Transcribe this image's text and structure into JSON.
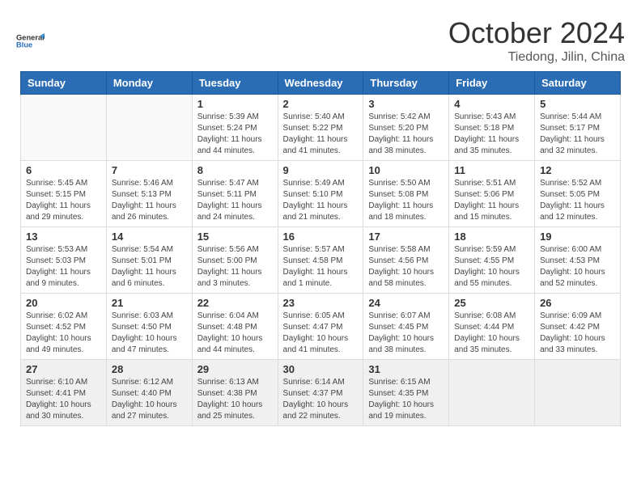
{
  "header": {
    "logo": {
      "general": "General",
      "blue": "Blue"
    },
    "title": "October 2024",
    "location": "Tiedong, Jilin, China"
  },
  "calendar": {
    "days_of_week": [
      "Sunday",
      "Monday",
      "Tuesday",
      "Wednesday",
      "Thursday",
      "Friday",
      "Saturday"
    ],
    "weeks": [
      [
        {
          "day": "",
          "empty": true
        },
        {
          "day": "",
          "empty": true
        },
        {
          "day": "1",
          "sunrise": "Sunrise: 5:39 AM",
          "sunset": "Sunset: 5:24 PM",
          "daylight": "Daylight: 11 hours and 44 minutes."
        },
        {
          "day": "2",
          "sunrise": "Sunrise: 5:40 AM",
          "sunset": "Sunset: 5:22 PM",
          "daylight": "Daylight: 11 hours and 41 minutes."
        },
        {
          "day": "3",
          "sunrise": "Sunrise: 5:42 AM",
          "sunset": "Sunset: 5:20 PM",
          "daylight": "Daylight: 11 hours and 38 minutes."
        },
        {
          "day": "4",
          "sunrise": "Sunrise: 5:43 AM",
          "sunset": "Sunset: 5:18 PM",
          "daylight": "Daylight: 11 hours and 35 minutes."
        },
        {
          "day": "5",
          "sunrise": "Sunrise: 5:44 AM",
          "sunset": "Sunset: 5:17 PM",
          "daylight": "Daylight: 11 hours and 32 minutes."
        }
      ],
      [
        {
          "day": "6",
          "sunrise": "Sunrise: 5:45 AM",
          "sunset": "Sunset: 5:15 PM",
          "daylight": "Daylight: 11 hours and 29 minutes."
        },
        {
          "day": "7",
          "sunrise": "Sunrise: 5:46 AM",
          "sunset": "Sunset: 5:13 PM",
          "daylight": "Daylight: 11 hours and 26 minutes."
        },
        {
          "day": "8",
          "sunrise": "Sunrise: 5:47 AM",
          "sunset": "Sunset: 5:11 PM",
          "daylight": "Daylight: 11 hours and 24 minutes."
        },
        {
          "day": "9",
          "sunrise": "Sunrise: 5:49 AM",
          "sunset": "Sunset: 5:10 PM",
          "daylight": "Daylight: 11 hours and 21 minutes."
        },
        {
          "day": "10",
          "sunrise": "Sunrise: 5:50 AM",
          "sunset": "Sunset: 5:08 PM",
          "daylight": "Daylight: 11 hours and 18 minutes."
        },
        {
          "day": "11",
          "sunrise": "Sunrise: 5:51 AM",
          "sunset": "Sunset: 5:06 PM",
          "daylight": "Daylight: 11 hours and 15 minutes."
        },
        {
          "day": "12",
          "sunrise": "Sunrise: 5:52 AM",
          "sunset": "Sunset: 5:05 PM",
          "daylight": "Daylight: 11 hours and 12 minutes."
        }
      ],
      [
        {
          "day": "13",
          "sunrise": "Sunrise: 5:53 AM",
          "sunset": "Sunset: 5:03 PM",
          "daylight": "Daylight: 11 hours and 9 minutes."
        },
        {
          "day": "14",
          "sunrise": "Sunrise: 5:54 AM",
          "sunset": "Sunset: 5:01 PM",
          "daylight": "Daylight: 11 hours and 6 minutes."
        },
        {
          "day": "15",
          "sunrise": "Sunrise: 5:56 AM",
          "sunset": "Sunset: 5:00 PM",
          "daylight": "Daylight: 11 hours and 3 minutes."
        },
        {
          "day": "16",
          "sunrise": "Sunrise: 5:57 AM",
          "sunset": "Sunset: 4:58 PM",
          "daylight": "Daylight: 11 hours and 1 minute."
        },
        {
          "day": "17",
          "sunrise": "Sunrise: 5:58 AM",
          "sunset": "Sunset: 4:56 PM",
          "daylight": "Daylight: 10 hours and 58 minutes."
        },
        {
          "day": "18",
          "sunrise": "Sunrise: 5:59 AM",
          "sunset": "Sunset: 4:55 PM",
          "daylight": "Daylight: 10 hours and 55 minutes."
        },
        {
          "day": "19",
          "sunrise": "Sunrise: 6:00 AM",
          "sunset": "Sunset: 4:53 PM",
          "daylight": "Daylight: 10 hours and 52 minutes."
        }
      ],
      [
        {
          "day": "20",
          "sunrise": "Sunrise: 6:02 AM",
          "sunset": "Sunset: 4:52 PM",
          "daylight": "Daylight: 10 hours and 49 minutes."
        },
        {
          "day": "21",
          "sunrise": "Sunrise: 6:03 AM",
          "sunset": "Sunset: 4:50 PM",
          "daylight": "Daylight: 10 hours and 47 minutes."
        },
        {
          "day": "22",
          "sunrise": "Sunrise: 6:04 AM",
          "sunset": "Sunset: 4:48 PM",
          "daylight": "Daylight: 10 hours and 44 minutes."
        },
        {
          "day": "23",
          "sunrise": "Sunrise: 6:05 AM",
          "sunset": "Sunset: 4:47 PM",
          "daylight": "Daylight: 10 hours and 41 minutes."
        },
        {
          "day": "24",
          "sunrise": "Sunrise: 6:07 AM",
          "sunset": "Sunset: 4:45 PM",
          "daylight": "Daylight: 10 hours and 38 minutes."
        },
        {
          "day": "25",
          "sunrise": "Sunrise: 6:08 AM",
          "sunset": "Sunset: 4:44 PM",
          "daylight": "Daylight: 10 hours and 35 minutes."
        },
        {
          "day": "26",
          "sunrise": "Sunrise: 6:09 AM",
          "sunset": "Sunset: 4:42 PM",
          "daylight": "Daylight: 10 hours and 33 minutes."
        }
      ],
      [
        {
          "day": "27",
          "sunrise": "Sunrise: 6:10 AM",
          "sunset": "Sunset: 4:41 PM",
          "daylight": "Daylight: 10 hours and 30 minutes.",
          "last": true
        },
        {
          "day": "28",
          "sunrise": "Sunrise: 6:12 AM",
          "sunset": "Sunset: 4:40 PM",
          "daylight": "Daylight: 10 hours and 27 minutes.",
          "last": true
        },
        {
          "day": "29",
          "sunrise": "Sunrise: 6:13 AM",
          "sunset": "Sunset: 4:38 PM",
          "daylight": "Daylight: 10 hours and 25 minutes.",
          "last": true
        },
        {
          "day": "30",
          "sunrise": "Sunrise: 6:14 AM",
          "sunset": "Sunset: 4:37 PM",
          "daylight": "Daylight: 10 hours and 22 minutes.",
          "last": true
        },
        {
          "day": "31",
          "sunrise": "Sunrise: 6:15 AM",
          "sunset": "Sunset: 4:35 PM",
          "daylight": "Daylight: 10 hours and 19 minutes.",
          "last": true
        },
        {
          "day": "",
          "empty": true,
          "last": true
        },
        {
          "day": "",
          "empty": true,
          "last": true
        }
      ]
    ]
  }
}
